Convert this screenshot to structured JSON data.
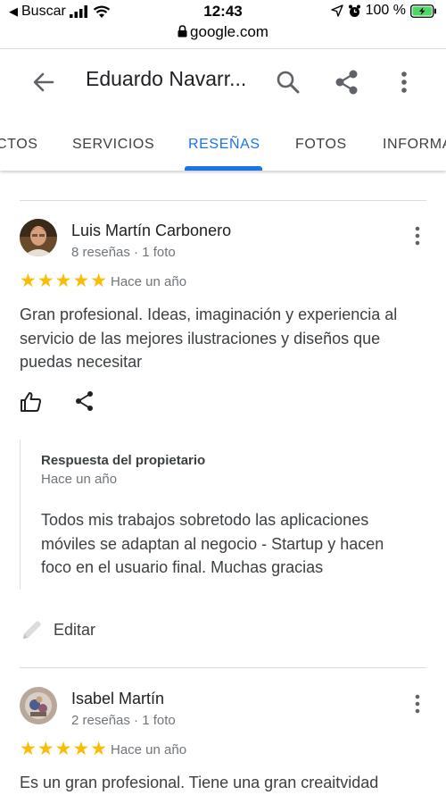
{
  "status_bar": {
    "back_app": "Buscar",
    "time": "12:43",
    "battery": "100 %",
    "url": "google.com"
  },
  "header": {
    "title": "Eduardo Navarr..."
  },
  "tabs": [
    {
      "label": "CTOS"
    },
    {
      "label": "SERVICIOS"
    },
    {
      "label": "RESEÑAS",
      "active": true
    },
    {
      "label": "FOTOS"
    },
    {
      "label": "INFORMA"
    }
  ],
  "colors": {
    "accent": "#1a73e8",
    "star": "#fbbc04",
    "battery": "#4cd964"
  },
  "reviews": [
    {
      "name": "Luis Martín Carbonero",
      "meta": "8 reseñas · 1 foto",
      "rating": 5,
      "stars": "★★★★★",
      "date": "Hace un año",
      "text": "Gran profesional. Ideas, imaginación y experiencia al servicio de las mejores ilustraciones y diseños que puedas necesitar",
      "owner_reply": {
        "title": "Respuesta del propietario",
        "date": "Hace un año",
        "text": "Todos mis trabajos sobretodo las aplicaciones móviles se adaptan al negocio - Startup y hacen foco en el usuario final. Muchas gracias"
      }
    },
    {
      "name": "Isabel Martín",
      "meta": "2 reseñas · 1 foto",
      "rating": 5,
      "stars": "★★★★★",
      "date": "Hace un año",
      "text": "Es un gran profesional. Tiene una gran creaitvidad"
    }
  ],
  "edit": {
    "label": "Editar"
  }
}
